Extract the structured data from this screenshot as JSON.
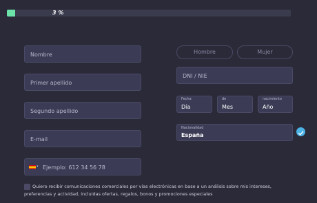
{
  "progress": {
    "percent_label": "3 %",
    "fraction": 0.03
  },
  "form": {
    "nombre_placeholder": "Nombre",
    "primer_apellido_placeholder": "Primer apellido",
    "segundo_apellido_placeholder": "Segundo apellido",
    "email_placeholder": "E-mail",
    "phone_placeholder": "Ejemplo: 612 34 56 78",
    "phone_flag": "spain-flag-icon",
    "dni_placeholder": "DNI / NIE"
  },
  "gender": {
    "male_label": "Hombre",
    "female_label": "Mujer"
  },
  "birthdate": {
    "day_label": "Fecha",
    "day_value": "Día",
    "month_label": "de",
    "month_value": "Mes",
    "year_label": "nacimiento",
    "year_value": "Año"
  },
  "nationality": {
    "label": "Nacionalidad",
    "value": "España",
    "check_icon": "check-circle-icon"
  },
  "consent": {
    "text": "Quiero recibir comunicaciones comerciales por vías electrónicas en base a un análisis sobre mis intereses, preferencias y actividad, incluidas ofertas, regalos, bonos y promociones especiales"
  },
  "colors": {
    "background": "#2a2a38",
    "field_bg": "#3b3b55",
    "progress_fill": "#6be3a9",
    "check_accent": "#4cb3e6"
  }
}
